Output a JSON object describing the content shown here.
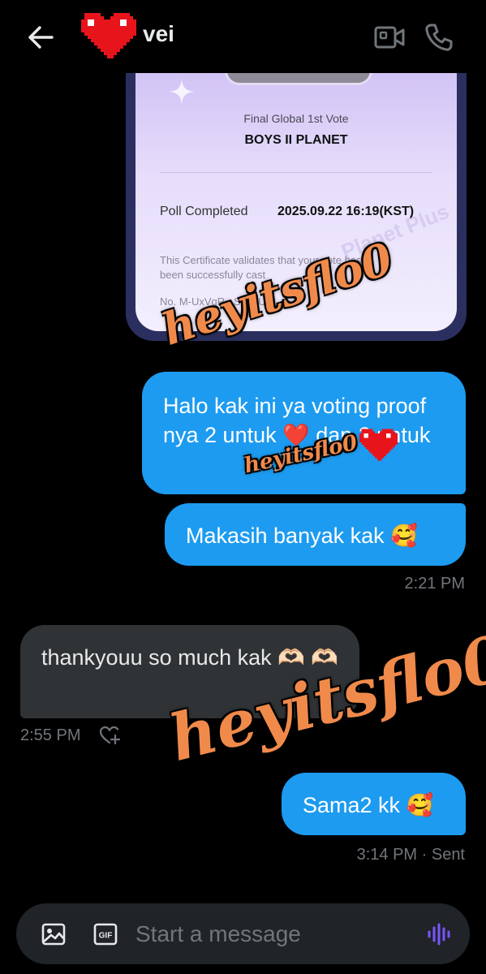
{
  "header": {
    "back_icon": "arrow-left-icon",
    "contact_emoji": "pixel-heart-icon",
    "contact_name": "vei",
    "video_icon": "video-camera-icon",
    "call_icon": "phone-icon"
  },
  "certificate": {
    "subtitle": "Final Global 1st Vote",
    "title": "BOYS II PLANET",
    "poll_label": "Poll Completed",
    "poll_date": "2025.09.22 16:19(KST)",
    "note": "This Certificate validates that your vote has been successfully cast",
    "code": "No. M-UxVqR...SDWUm",
    "faint_brand": "Planet Plus"
  },
  "messages": [
    {
      "direction": "out",
      "text": "Halo kak ini ya voting proof nya 2 untuk ❤️ dan 2 untuk"
    },
    {
      "direction": "out",
      "text": "Makasih banyak kak 🥰"
    },
    {
      "direction": "in",
      "text": "thankyouu so much kak 🫶🏻 🫶🏻"
    },
    {
      "direction": "out",
      "text": "Sama2 kk 🥰"
    }
  ],
  "timestamps": {
    "out_group_1": "2:21 PM",
    "in_group": "2:55 PM",
    "out_group_2": "3:14 PM · Sent"
  },
  "watermark": "heyitsflo0",
  "composer": {
    "placeholder": "Start a message",
    "image_icon": "image-icon",
    "gif_icon": "gif-icon",
    "voice_icon": "voice-wave-icon"
  },
  "colors": {
    "background": "#000000",
    "outgoing_bubble": "#1d9bf0",
    "incoming_bubble": "#2f3336",
    "muted_text": "#71767b",
    "watermark": "#f08a4b"
  }
}
